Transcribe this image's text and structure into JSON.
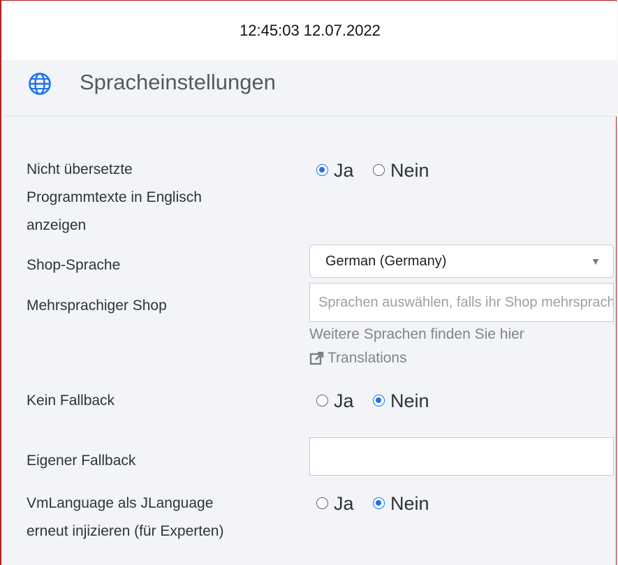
{
  "timestamp": "12:45:03 12.07.2022",
  "header": {
    "title": "Spracheinstellungen",
    "icon": "globe-icon"
  },
  "accent_color": "#1a73e8",
  "settings": {
    "untranslated": {
      "label_line1": "Nicht übersetzte",
      "label_line2": "Programmtexte in Englisch",
      "label_line3": "anzeigen",
      "yes": "Ja",
      "no": "Nein",
      "selected": "Ja"
    },
    "shop_language": {
      "label": "Shop-Sprache",
      "value": "German (Germany)"
    },
    "multilang": {
      "label": "Mehrsprachiger Shop",
      "placeholder": "Sprachen auswählen, falls ihr Shop mehrsprachig ist",
      "hint": "Weitere Sprachen finden Sie hier",
      "link": "Translations"
    },
    "no_fallback": {
      "label": "Kein Fallback",
      "yes": "Ja",
      "no": "Nein",
      "selected": "Nein"
    },
    "own_fallback": {
      "label": "Eigener Fallback",
      "value": ""
    },
    "vmlanguage": {
      "label_line1": "VmLanguage als JLanguage",
      "label_line2": "erneut injizieren (für Experten)",
      "yes": "Ja",
      "no": "Nein",
      "selected": "Nein"
    }
  }
}
